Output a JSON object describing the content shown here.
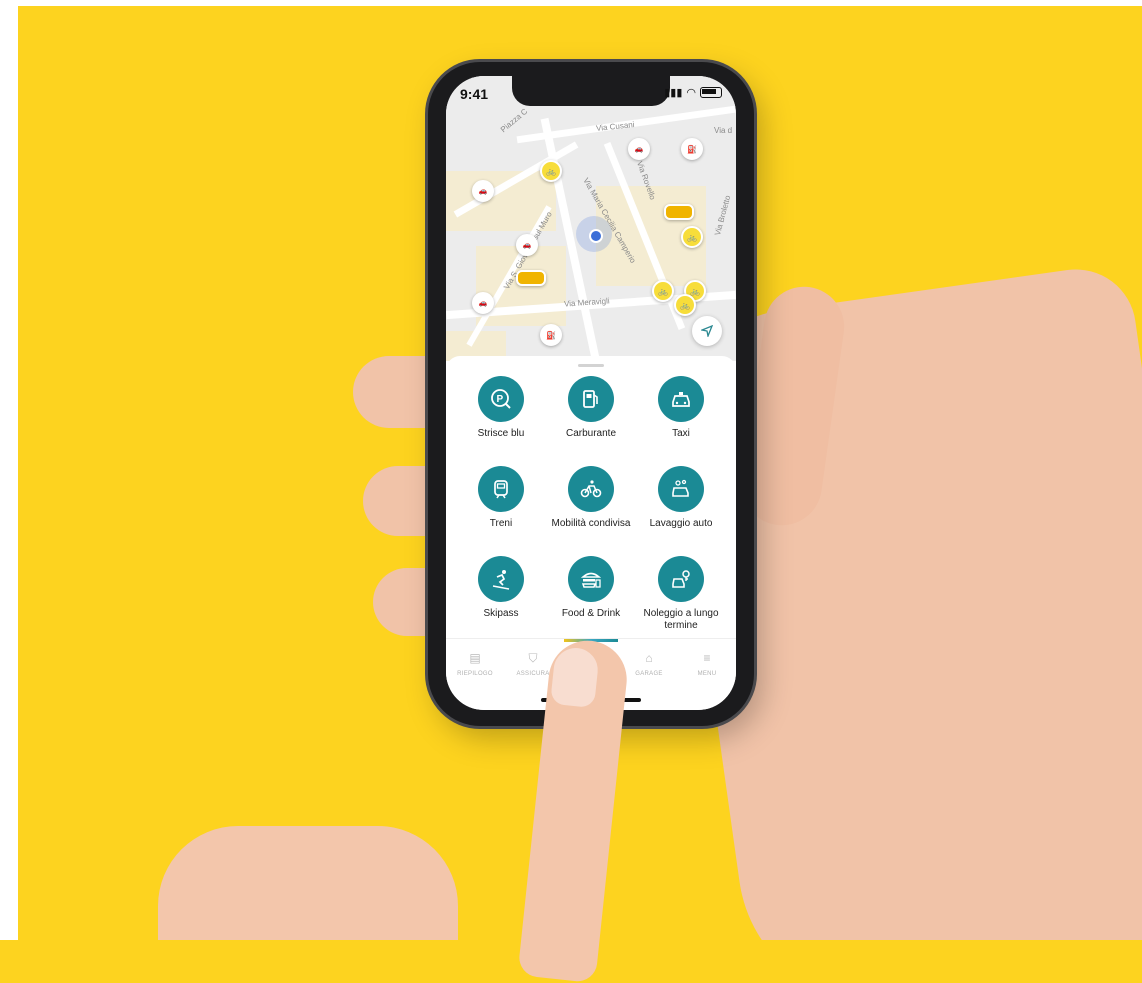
{
  "status_bar": {
    "time": "9:41"
  },
  "map": {
    "streets": [
      "Piazza C",
      "Via Cusani",
      "Via d",
      "Via Rovello",
      "Via Broletto",
      "Via Meravigli",
      "Via S. Giovanni sul Muro",
      "Via Maria Cecilia Camperio"
    ]
  },
  "services": [
    {
      "label": "Strisce blu",
      "icon": "parking-search-icon"
    },
    {
      "label": "Carburante",
      "icon": "fuel-pump-icon"
    },
    {
      "label": "Taxi",
      "icon": "taxi-icon"
    },
    {
      "label": "Treni",
      "icon": "train-icon"
    },
    {
      "label": "Mobilità condivisa",
      "icon": "shared-bike-icon"
    },
    {
      "label": "Lavaggio auto",
      "icon": "car-wash-icon"
    },
    {
      "label": "Skipass",
      "icon": "skier-icon"
    },
    {
      "label": "Food & Drink",
      "icon": "burger-drink-icon"
    },
    {
      "label": "Noleggio a lungo termine",
      "icon": "car-rental-key-icon"
    }
  ],
  "tabbar": [
    {
      "label": "RIEPILOGO",
      "icon": "summary-icon"
    },
    {
      "label": "ASSICURA",
      "icon": "shield-icon"
    },
    {
      "label": "",
      "icon": "services-icon",
      "active": true
    },
    {
      "label": "GARAGE",
      "icon": "car-icon"
    },
    {
      "label": "MENU",
      "icon": "menu-icon"
    }
  ],
  "colors": {
    "background": "#fdd31f",
    "accent": "#1b8a95"
  }
}
